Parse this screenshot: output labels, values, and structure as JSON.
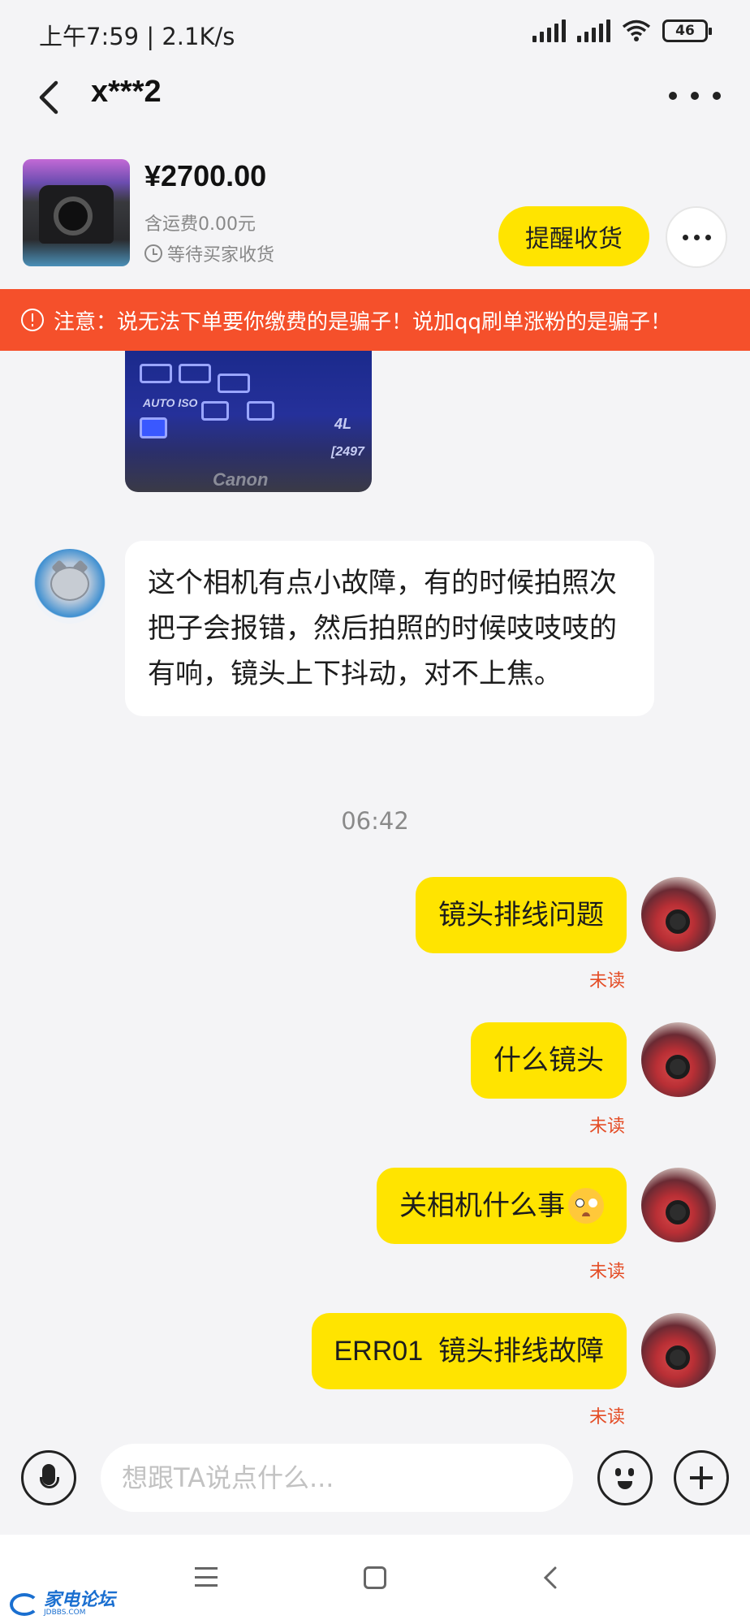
{
  "status_bar": {
    "time": "上午7:59",
    "speed": "2.1K/s",
    "battery": "46"
  },
  "header": {
    "title": "x***2"
  },
  "product": {
    "price": "¥2700.00",
    "shipping": "含运费0.00元",
    "status": "等待买家收货",
    "remind_button": "提醒收货"
  },
  "warning": {
    "text": "注意：说无法下单要你缴费的是骗子！说加qq刷单涨粉的是骗子！"
  },
  "chat_image": {
    "badge": "4L",
    "counter": "[2497",
    "brand": "Canon",
    "autoiso": "AUTO ISO"
  },
  "messages": {
    "incoming_1": "这个相机有点小故障，有的时候拍照次把子会报错，然后拍照的时候吱吱吱的有响，镜头上下抖动，对不上焦。",
    "timestamp": "06:42",
    "out_1": "镜头排线问题",
    "out_2": "什么镜头",
    "out_3": "关相机什么事",
    "out_4": "ERR01  镜头排线故障",
    "unread_label": "未读"
  },
  "input": {
    "placeholder": "想跟TA说点什么..."
  },
  "watermark": {
    "text": "家电论坛",
    "sub": "JDBBS.COM"
  },
  "colors": {
    "accent": "#ffe400",
    "warning": "#f5502b",
    "unread": "#e44d26"
  }
}
